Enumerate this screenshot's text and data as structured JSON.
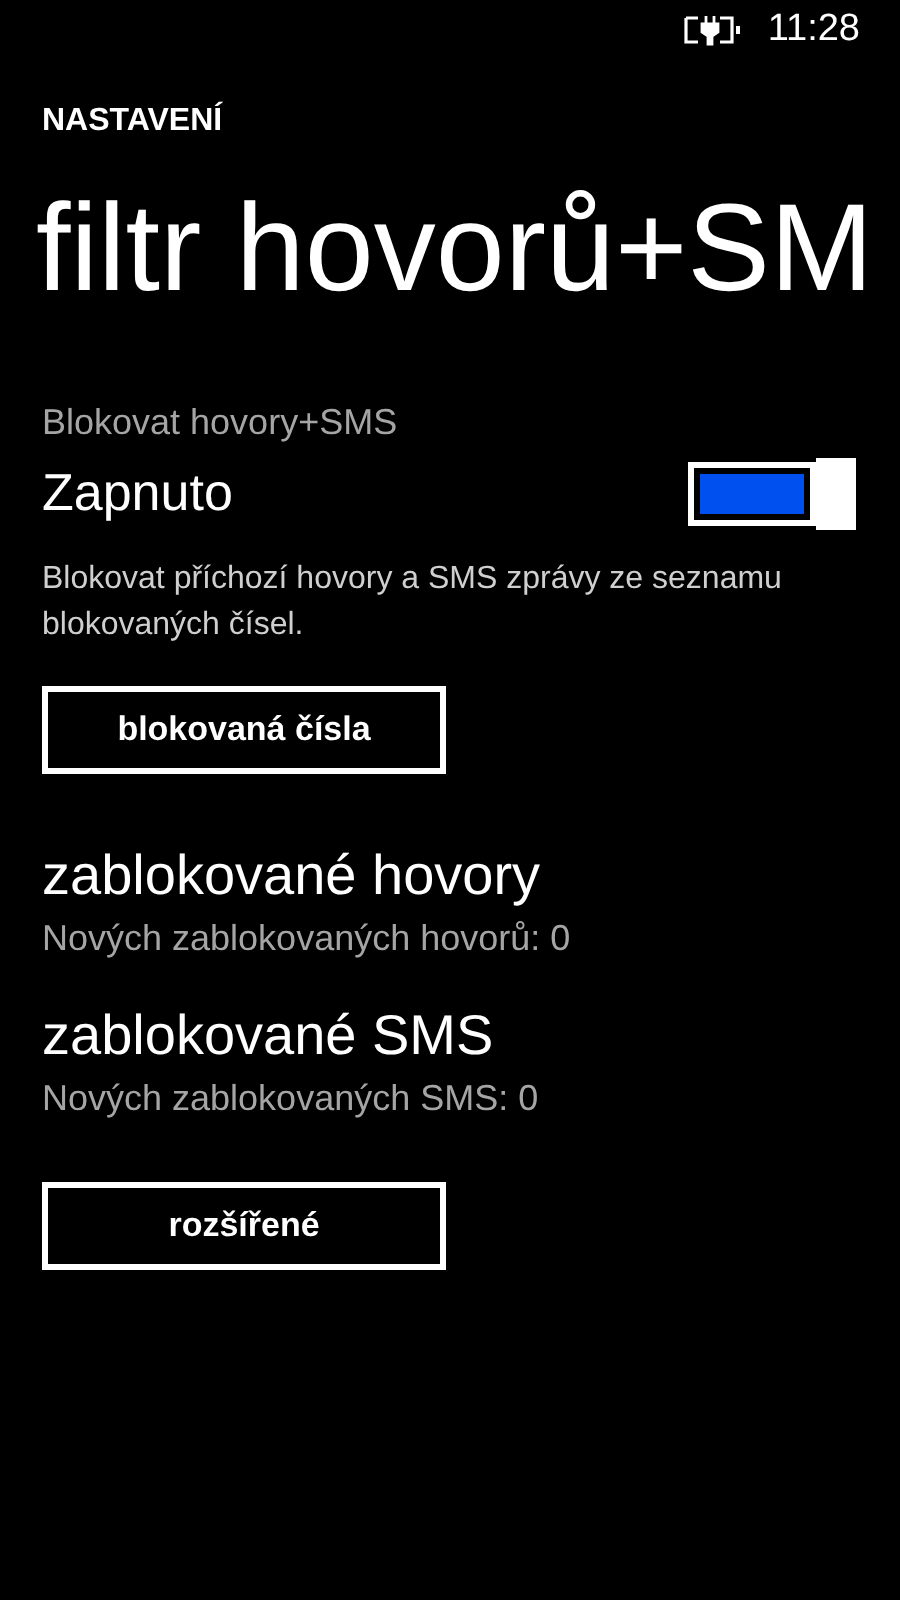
{
  "status_bar": {
    "time": "11:28"
  },
  "header": "NASTAVENÍ",
  "title": "filtr hovorů+SM",
  "block_setting": {
    "label": "Blokovat hovory+SMS",
    "state_text": "Zapnuto",
    "on": true,
    "description": "Blokovat příchozí hovory a SMS zprávy ze seznamu blokovaných čísel."
  },
  "blocked_numbers_button": "blokovaná čísla",
  "sections": [
    {
      "title": "zablokované hovory",
      "subtitle": "Nových zablokovaných hovorů: 0"
    },
    {
      "title": "zablokované SMS",
      "subtitle": "Nových zablokovaných SMS: 0"
    }
  ],
  "advanced_button": "rozšířené"
}
